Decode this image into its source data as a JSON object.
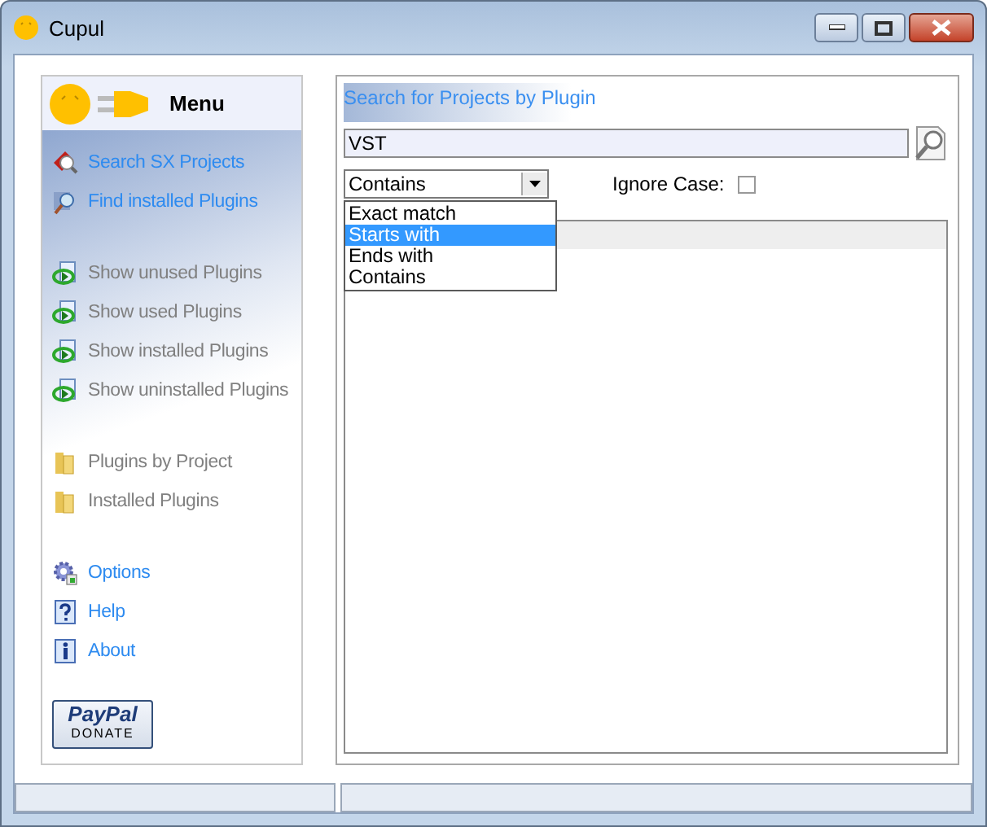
{
  "window": {
    "title": "Cupul"
  },
  "menu": {
    "title": "Menu",
    "sections": [
      {
        "items": [
          {
            "label": "Search SX Projects",
            "kind": "search",
            "disabled": false
          },
          {
            "label": "Find installed Plugins",
            "kind": "find",
            "disabled": false
          }
        ]
      },
      {
        "items": [
          {
            "label": "Show unused Plugins",
            "kind": "view",
            "disabled": true
          },
          {
            "label": "Show used Plugins",
            "kind": "view",
            "disabled": true
          },
          {
            "label": "Show installed Plugins",
            "kind": "view",
            "disabled": true
          },
          {
            "label": "Show uninstalled Plugins",
            "kind": "view",
            "disabled": true
          }
        ]
      },
      {
        "items": [
          {
            "label": "Plugins by Project",
            "kind": "folder",
            "disabled": true
          },
          {
            "label": "Installed Plugins",
            "kind": "folder",
            "disabled": true
          }
        ]
      },
      {
        "items": [
          {
            "label": "Options",
            "kind": "options",
            "disabled": false
          },
          {
            "label": "Help",
            "kind": "help",
            "disabled": false
          },
          {
            "label": "About",
            "kind": "about",
            "disabled": false
          }
        ]
      }
    ],
    "donate": {
      "brand": "PayPal",
      "label": "DONATE"
    }
  },
  "search": {
    "title": "Search for Projects by Plugin",
    "value": "VST",
    "match": "Contains",
    "options": [
      {
        "label": "Exact match",
        "selected": false
      },
      {
        "label": "Starts with",
        "selected": true
      },
      {
        "label": "Ends with",
        "selected": false
      },
      {
        "label": "Contains",
        "selected": false
      }
    ],
    "ignore_case": {
      "label": "Ignore Case:",
      "checked": false
    }
  }
}
